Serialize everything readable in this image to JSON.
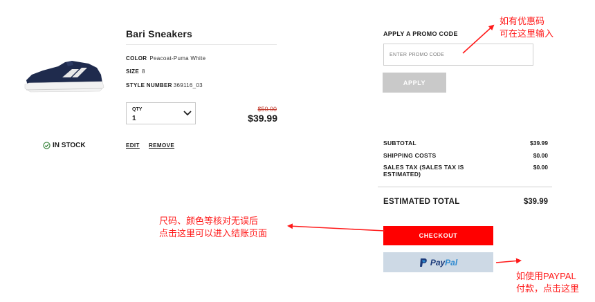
{
  "product": {
    "name": "Bari Sneakers",
    "color_label": "COLOR",
    "color_value": "Peacoat-Puma White",
    "size_label": "SIZE",
    "size_value": "8",
    "style_label": "STYLE NUMBER",
    "style_value": "369116_03",
    "qty_label": "QTY",
    "qty_value": "1",
    "old_price": "$50.00",
    "price": "$39.99",
    "stock_status": "IN STOCK",
    "edit_label": "EDIT",
    "remove_label": "REMOVE"
  },
  "promo": {
    "title": "APPLY A PROMO CODE",
    "placeholder": "ENTER PROMO CODE",
    "apply_label": "APPLY"
  },
  "summary": {
    "subtotal_label": "SUBTOTAL",
    "subtotal_value": "$39.99",
    "shipping_label": "SHIPPING COSTS",
    "shipping_value": "$0.00",
    "tax_label_line1": "SALES TAX (SALES TAX IS",
    "tax_label_line2": "ESTIMATED)",
    "tax_value": "$0.00",
    "total_label": "ESTIMATED TOTAL",
    "total_value": "$39.99"
  },
  "buttons": {
    "checkout_label": "CHECKOUT",
    "paypal_pay": "Pay",
    "paypal_pal": "Pal"
  },
  "annotations": {
    "promo_line1": "如有优惠码",
    "promo_line2": "可在这里输入",
    "checkout_line1": "尺码、颜色等核对无误后",
    "checkout_line2": "点击这里可以进入结账页面",
    "paypal_line1": "如使用PAYPAL",
    "paypal_line2": "付款，点击这里"
  },
  "colors": {
    "checkout": "#ff0000",
    "paypal_bg": "#cdd9e5",
    "annotation": "#ff1a1a",
    "apply_disabled": "#c9c9c9",
    "stock_icon": "#2e7d32"
  },
  "icons": {
    "stock": "check-circle-icon",
    "qty": "chevron-down-icon",
    "paypal": "paypal-logo-icon"
  }
}
